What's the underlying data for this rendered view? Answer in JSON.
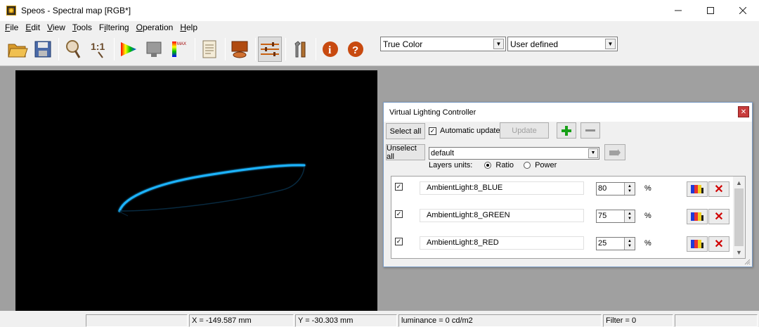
{
  "window": {
    "title": "Speos - Spectral map [RGB*]",
    "controls": {
      "minimize": "—",
      "maximize": "☐",
      "close": "✕"
    }
  },
  "menu": {
    "items": [
      {
        "label": "File",
        "accel": "F",
        "rest": "ile"
      },
      {
        "label": "Edit",
        "accel": "E",
        "rest": "dit"
      },
      {
        "label": "View",
        "accel": "V",
        "rest": "iew"
      },
      {
        "label": "Tools",
        "accel": "T",
        "rest": "ools"
      },
      {
        "label": "Filtering",
        "pre": "F",
        "accel": "i",
        "rest": "ltering"
      },
      {
        "label": "Operation",
        "accel": "O",
        "rest": "peration"
      },
      {
        "label": "Help",
        "accel": "H",
        "rest": "elp"
      }
    ]
  },
  "toolbar": {
    "zoom_ratio_label": "1:1",
    "max_label": "MAX",
    "color_mode_select": "True Color",
    "scale_select": "User defined",
    "icons": [
      "open-icon",
      "save-icon",
      "zoom-icon",
      "zoom-1-1-icon",
      "color-wheel-icon",
      "monitor-icon",
      "luminance-scale-icon",
      "report-icon",
      "surface-icon",
      "settings-sliders-icon",
      "tools-icon",
      "info-icon",
      "help-icon"
    ]
  },
  "status": {
    "x": "X = -149.587 mm",
    "y": "Y = -30.303 mm",
    "luminance": "luminance = 0 cd/m2",
    "filter": "Filter = 0"
  },
  "controller": {
    "title": "Virtual Lighting Controller",
    "select_all": "Select all",
    "unselect_all": "Unselect all",
    "automatic_update": "Automatic update",
    "automatic_update_checked": true,
    "update": "Update",
    "add": "+",
    "remove": "—",
    "preset": "default",
    "layers_units_label": "Layers units:",
    "units": {
      "ratio": "Ratio",
      "power": "Power",
      "selected": "Ratio"
    },
    "percent_symbol": "%",
    "layers": [
      {
        "checked": true,
        "name": "AmbientLight:8_BLUE",
        "value": "80"
      },
      {
        "checked": true,
        "name": "AmbientLight:8_GREEN",
        "value": "75"
      },
      {
        "checked": true,
        "name": "AmbientLight:8_RED",
        "value": "25"
      }
    ]
  },
  "colors": {
    "viewport_bg": "#a0a0a0",
    "canvas_bg": "#000000",
    "beam": "#1fb4ff",
    "delete_red": "#d00000"
  }
}
